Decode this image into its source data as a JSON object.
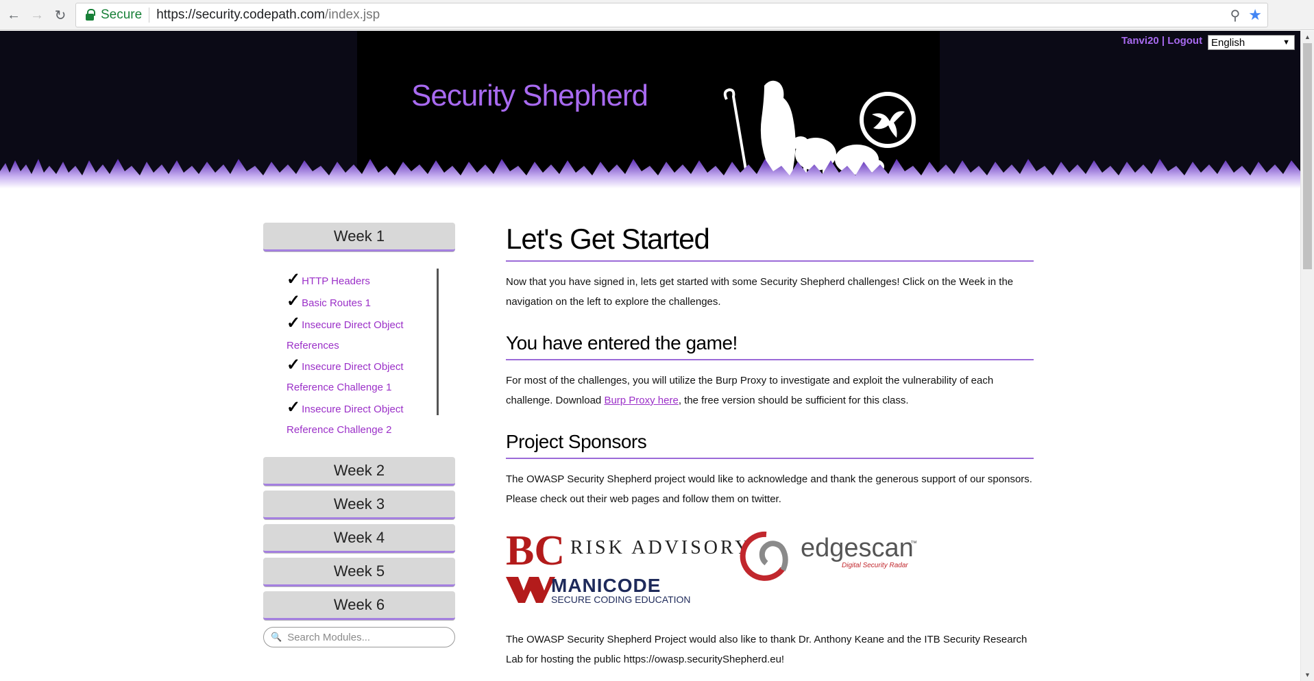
{
  "browser": {
    "secure_label": "Secure",
    "url_host": "https://security.codepath.com",
    "url_path": "/index.jsp"
  },
  "header": {
    "site_title": "Security Shepherd",
    "user_link": "Tanvi20 | Logout",
    "language": "English"
  },
  "sidebar": {
    "weeks": [
      "Week 1",
      "Week 2",
      "Week 3",
      "Week 4",
      "Week 5",
      "Week 6"
    ],
    "modules": [
      {
        "check": "✓",
        "line1": "HTTP Headers",
        "line2": ""
      },
      {
        "check": "✓",
        "line1": "Basic Routes 1",
        "line2": ""
      },
      {
        "check": "✓",
        "line1": "Insecure Direct Object",
        "line2": "References"
      },
      {
        "check": "✓",
        "line1": "Insecure Direct Object",
        "line2": "Reference Challenge 1"
      },
      {
        "check": "✓",
        "line1": "Insecure Direct Object",
        "line2": "Reference Challenge 2"
      }
    ],
    "search_placeholder": "Search Modules..."
  },
  "main": {
    "title": "Let's Get Started",
    "intro": "Now that you have signed in, lets get started with some Security Shepherd challenges! Click on the Week in the navigation on the left to explore the challenges.",
    "game_heading": "You have entered the game!",
    "game_text_1": "For most of the challenges, you will utilize the Burp Proxy to investigate and exploit the vulnerability of each challenge. Download ",
    "game_link": "Burp Proxy here",
    "game_text_2": ", the free version should be sufficient for this class.",
    "sponsors_heading": "Project Sponsors",
    "sponsors_text": "The OWASP Security Shepherd project would like to acknowledge and thank the generous support of our sponsors. Please check out their web pages and follow them on twitter.",
    "thanks_text": "The OWASP Security Shepherd Project would also like to thank Dr. Anthony Keane and the ITB Security Research Lab for hosting the public https://owasp.securityShepherd.eu!"
  },
  "sponsors": {
    "bc_monogram": "BC",
    "risk_advisory": "RISK ADVISORY",
    "edgescan": "edgescan",
    "edgescan_tm": "™",
    "edgescan_tagline": "Digital Security Radar",
    "manicode": "MANICODE",
    "manicode_tagline": "SECURE CODING EDUCATION"
  },
  "colors": {
    "accent": "#a86af0",
    "link": "#9b30c8",
    "header_bg": "#000000"
  }
}
